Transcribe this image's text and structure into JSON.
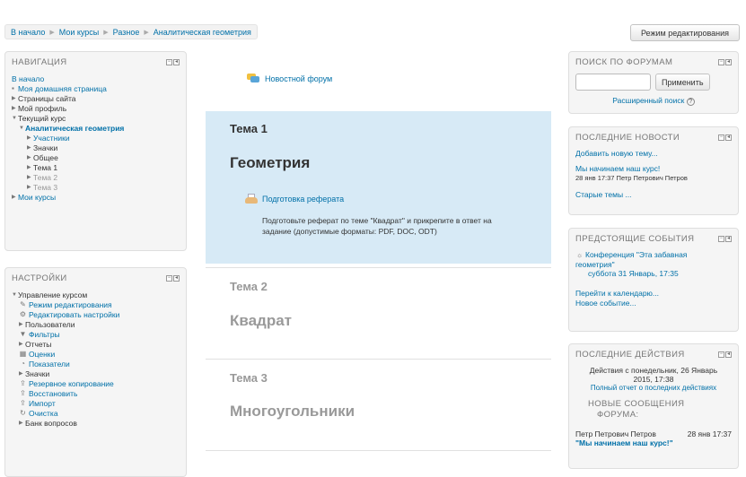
{
  "breadcrumb": [
    "В начало",
    "Мои курсы",
    "Разное",
    "Аналитическая геометрия"
  ],
  "header": {
    "edit_mode_button": "Режим редактирования"
  },
  "navigation": {
    "title": "НАВИГАЦИЯ",
    "home": "В начало",
    "items": [
      "Моя домашняя страница",
      "Страницы сайта",
      "Мой профиль",
      "Текущий курс"
    ],
    "course": "Аналитическая геометрия",
    "course_items": [
      "Участники",
      "Значки",
      "Общее",
      "Тема 1",
      "Тема 2",
      "Тема 3"
    ],
    "my_courses": "Мои курсы"
  },
  "settings": {
    "title": "НАСТРОЙКИ",
    "root": "Управление курсом",
    "items": [
      "Режим редактирования",
      "Редактировать настройки",
      "Пользователи",
      "Фильтры",
      "Отчеты",
      "Оценки",
      "Показатели",
      "Значки",
      "Резервное копирование",
      "Восстановить",
      "Импорт",
      "Очистка",
      "Банк вопросов"
    ]
  },
  "main": {
    "news_forum": "Новостной форум",
    "sections": [
      {
        "label": "Тема 1",
        "title": "Геометрия"
      },
      {
        "label": "Тема 2",
        "title": "Квадрат"
      },
      {
        "label": "Тема 3",
        "title": "Многоугольники"
      }
    ],
    "assignment": {
      "name": "Подготовка реферата",
      "description_line1": "Подготовьте реферат по теме \"Квадрат\" и прикрепите в ответ на",
      "description_line2": "задание (допустимые форматы: PDF, DOC, ODT)"
    }
  },
  "forum_search": {
    "title": "ПОИСК ПО ФОРУМАМ",
    "apply_button": "Применить",
    "advanced": "Расширенный поиск",
    "help_icon": "?"
  },
  "latest_news": {
    "title": "ПОСЛЕДНИЕ НОВОСТИ",
    "add_topic": "Добавить новую тему...",
    "item_title": "Мы начинаем наш курс!",
    "item_meta": "28 янв 17:37  Петр Петрович Петров",
    "old_topics": "Старые темы ..."
  },
  "upcoming_events": {
    "title": "ПРЕДСТОЯЩИЕ СОБЫТИЯ",
    "event_line1": "Конференция \"Эта забавная",
    "event_line2": "геометрия\"",
    "event_date": "суббота 31 Январь, 17:35",
    "go_calendar": "Перейти к календарю...",
    "new_event": "Новое событие..."
  },
  "recent_activity": {
    "title": "ПОСЛЕДНИЕ ДЕЙСТВИЯ",
    "since_line1": "Действия с понедельник, 26 Январь",
    "since_line2": "2015, 17:38",
    "full_report": "Полный отчет о последних действиях",
    "new_posts_line1": "НОВЫЕ СООБЩЕНИЯ",
    "new_posts_line2": "ФОРУМА:",
    "post_author": "Петр Петрович Петров",
    "post_time": "28 янв 17:37",
    "post_title": "\"Мы начинаем наш курс!\""
  },
  "colors": {
    "link": "#0070a8",
    "current_section_bg": "#d7eaf6",
    "block_bg": "#f5f5f5"
  }
}
